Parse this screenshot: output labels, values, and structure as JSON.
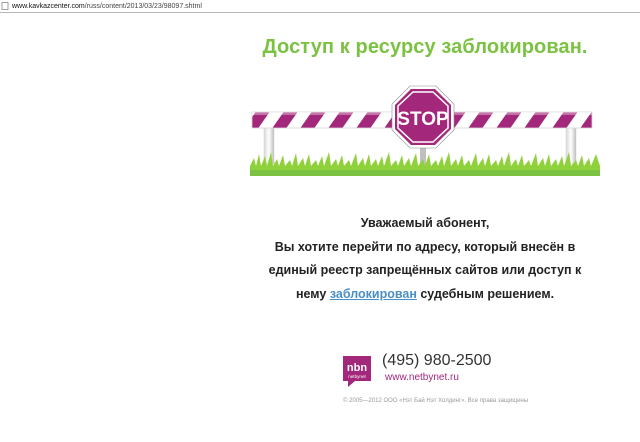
{
  "browser": {
    "url_host": "www.kavkazcenter.com",
    "url_path": "/russ/content/2013/03/23/98097.shtml"
  },
  "notice": {
    "headline": "Доступ к ресурсу заблокирован.",
    "sign_text": "STOP",
    "message": {
      "line1": "Уважаемый абонент,",
      "line2": "Вы хотите перейти по адресу, который внесён в",
      "line3": "единый реестр запрещённых сайтов или доступ к",
      "line4_before": "нему",
      "line4_link": "заблокирован",
      "line4_after": "судебным решением."
    }
  },
  "footer": {
    "logo_top": "nbn",
    "logo_bottom": "netbynet",
    "phone": "(495) 980-2500",
    "website": "www.netbynet.ru",
    "copyright": "© 2005—2012 ООО «Нэт Бай Нэт Холдинг». Все права защищены"
  },
  "colors": {
    "headline_green": "#7cc242",
    "stop_purple": "#a3287b",
    "link_blue": "#4a8fc6"
  }
}
